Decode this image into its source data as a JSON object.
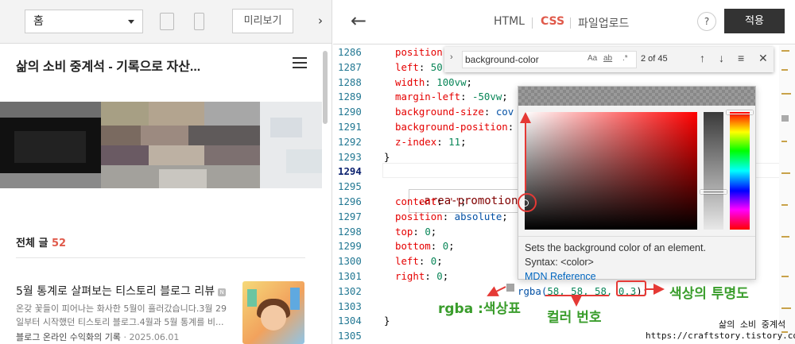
{
  "left_panel": {
    "page_select": "홈",
    "preview_button": "미리보기",
    "collapse_icon": "›",
    "blog_title": "삶의 소비 중계석 - 기록으로 자산...",
    "post_count_label": "전체 글",
    "post_count": "52",
    "post": {
      "title": "5월 통계로 살펴보는 티스토리 블로그 리뷰",
      "new_badge": "N",
      "excerpt": "온갖 꽃들이 피어나는 화사한 5월이 흘러갔습니다.3월 29일부터 시작했던 티스토리 블로그.4월과 5월 통계를 비...",
      "category": "블로그 온라인 수익화의 기록",
      "date": "2025.06.01"
    }
  },
  "editor": {
    "back_icon": "←",
    "tabs": [
      {
        "label": "HTML",
        "active": false
      },
      {
        "label": "CSS",
        "active": true
      },
      {
        "label": "파일업로드",
        "active": false
      }
    ],
    "help": "?",
    "apply_button": "적용",
    "find": {
      "query": "background-color",
      "match_case": "Aa",
      "whole_word": "ab",
      "regex": ".*",
      "result": "2 of 45",
      "toggle_icon": "›",
      "prev_icon": "↑",
      "next_icon": "↓",
      "selection_icon": "≡",
      "close_icon": "✕"
    },
    "line_numbers": [
      "1286",
      "1287",
      "1288",
      "1289",
      "1290",
      "1291",
      "1292",
      "1293",
      "1294",
      "1295",
      "1296",
      "1297",
      "1298",
      "1299",
      "1300",
      "1301",
      "1302",
      "1303",
      "1304",
      "1305"
    ],
    "current_line": "1294",
    "code": {
      "l1286": [
        "position",
        ""
      ],
      "l1287": [
        "left",
        "50"
      ],
      "l1288": [
        "width",
        "100vw"
      ],
      "l1289": [
        "margin-left",
        "-50vw"
      ],
      "l1290": [
        "background-size",
        "cov"
      ],
      "l1291": [
        "background-position",
        ""
      ],
      "l1292": [
        "z-index",
        "11"
      ],
      "l1293": "}",
      "l1295": ".area-promotion:before",
      "l1296": [
        "content",
        "''"
      ],
      "l1297": [
        "position",
        "absolute"
      ],
      "l1298": [
        "top",
        "0"
      ],
      "l1299": [
        "bottom",
        "0"
      ],
      "l1300": [
        "left",
        "0"
      ],
      "l1301": [
        "right",
        "0"
      ],
      "l1302_func": "rgba(",
      "l1302_args": "58, 58, 58, ",
      "l1302_alpha": "0.3",
      "l1302_end": ");",
      "l1304": "}"
    },
    "color_picker": {
      "description": "Sets the background color of an element.",
      "syntax": "Syntax: <color>",
      "link": "MDN Reference",
      "value_rgba": "rgba(58, 58, 58, 0.3)"
    }
  },
  "annotations": {
    "rgba_label": "rgba :색상표",
    "color_number_label": "컬러 번호",
    "transparency_label": "색상의 투명도",
    "color": "#3a9d2c",
    "marker_color": "#e53935"
  },
  "credit": {
    "name": "삶의 소비 중계석",
    "url": "https://craftstory.tistory.com/"
  }
}
